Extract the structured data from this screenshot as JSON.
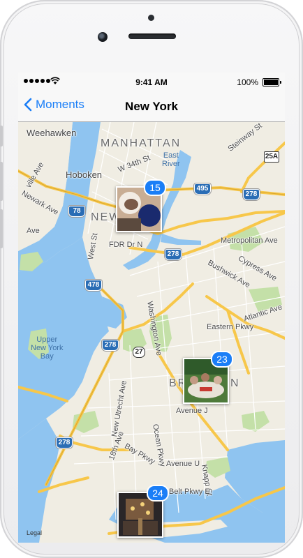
{
  "status_bar": {
    "time": "9:41 AM",
    "battery_percent": "100%",
    "signal_dots": 5,
    "icons": [
      "signal-dots-icon",
      "wifi-icon",
      "battery-icon"
    ]
  },
  "nav_bar": {
    "back_label": "Moments",
    "back_icon": "chevron-left-icon",
    "title": "New York",
    "accent_color": "#1a7ef7"
  },
  "map": {
    "area_labels": {
      "manhattan": "MANHATTAN",
      "brooklyn_part1": "BR",
      "brooklyn_part2": "N",
      "new_york": "NEW"
    },
    "place_labels": {
      "weehawken": "Weehawken",
      "hoboken": "Hoboken",
      "west_34": "W 34th St",
      "east_river": "East\nRiver",
      "steinway": "Steinway St",
      "metropolitan": "Metropolitan Ave",
      "cypress": "Cypress Ave",
      "bushwick": "Bushwick Ave",
      "atlantic": "Atlantic Ave",
      "eastern_pkwy": "Eastern Pkwy",
      "washington": "Washington Ave",
      "fdr": "FDR Dr N",
      "west_st": "West St",
      "newark": "Newark Ave",
      "upper_bay": "Upper\nNew York\nBay",
      "avenue_j": "Avenue J",
      "new_utrecht": "New Utrecht Ave",
      "eighteenth": "18th Ave",
      "bay_pkwy": "Bay Pkwy",
      "ocean_pkwy": "Ocean Pkwy",
      "avenue_u": "Avenue U",
      "knapp": "Knapp St",
      "belt": "Belt Pkwy E",
      "ave_left": "Ave",
      "ville": "ville Ave"
    },
    "shields": {
      "i495": "495",
      "i278_a": "278",
      "i278_b": "278",
      "i278_c": "278",
      "i278_d": "278",
      "i78": "78",
      "i478": "478",
      "r25a": "25A",
      "r27": "27"
    },
    "photo_clusters": [
      {
        "count": "15"
      },
      {
        "count": "23"
      },
      {
        "count": "24"
      }
    ],
    "legal": "Legal",
    "colors": {
      "water": "#8fc4f0",
      "land": "#f0ede3",
      "park": "#c4e0a8",
      "highway": "#f7c74a"
    }
  }
}
